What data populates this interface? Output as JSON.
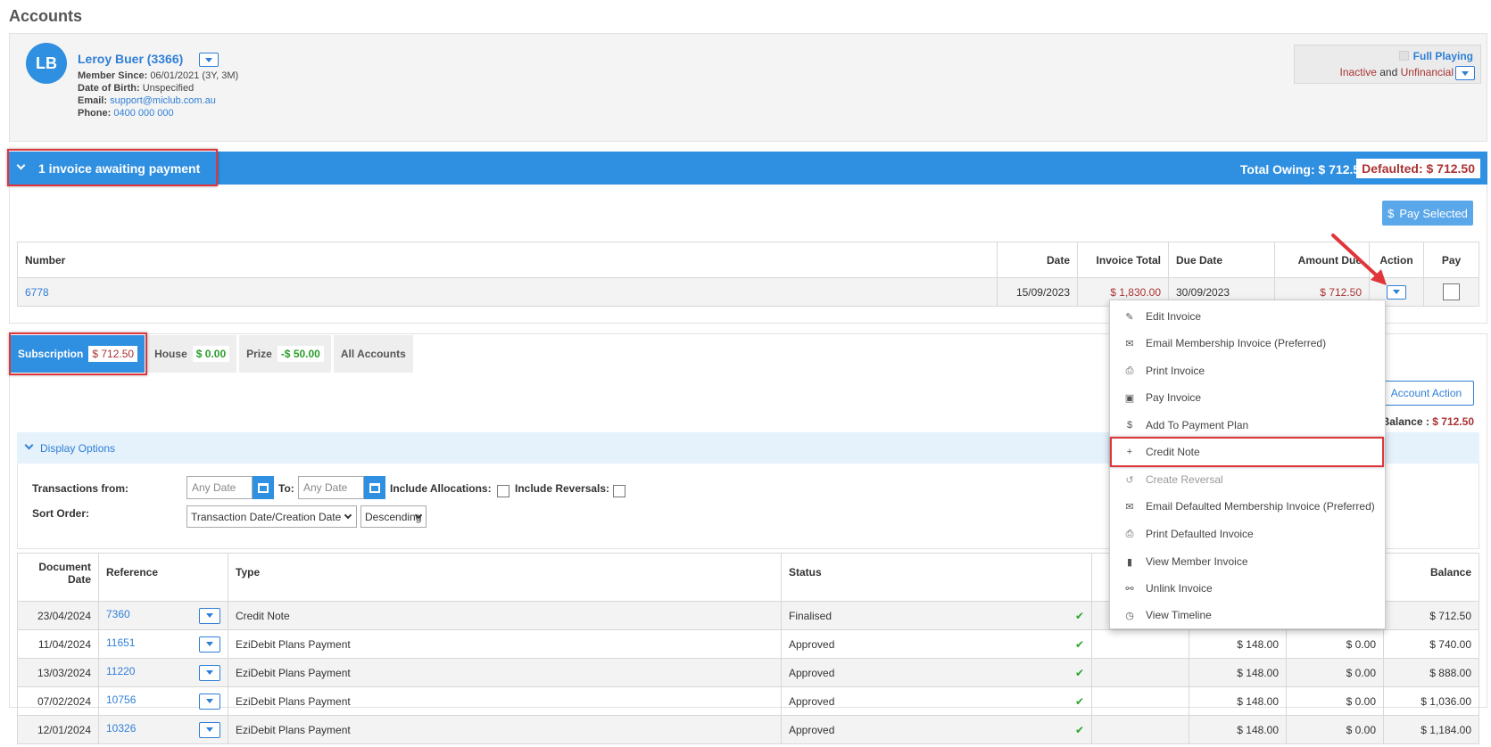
{
  "page": {
    "title": "Accounts"
  },
  "member": {
    "initials": "LB",
    "name": "Leroy Buer (3366)",
    "since_label": "Member Since:",
    "since_value": "06/01/2021 (3Y, 3M)",
    "dob_label": "Date of Birth:",
    "dob_value": "Unspecified",
    "email_label": "Email:",
    "email_value": "support@miclub.com.au",
    "phone_label": "Phone:",
    "phone_value": "0400 000 000",
    "status_title": "Full Playing",
    "status_inactive": "Inactive",
    "status_and": "and",
    "status_unfinancial": "Unfinancial"
  },
  "invoice_banner": {
    "title": "1 invoice awaiting payment",
    "total_owing": "Total Owing: $ 712.50",
    "defaulted": "Defaulted: $ 712.50"
  },
  "pay_selected_label": "Pay Selected",
  "invoice_table": {
    "headers": {
      "number": "Number",
      "date": "Date",
      "total": "Invoice Total",
      "due": "Due Date",
      "amount_due": "Amount Due",
      "action": "Action",
      "pay": "Pay"
    },
    "rows": [
      {
        "number": "6778",
        "date": "15/09/2023",
        "total": "$ 1,830.00",
        "due": "30/09/2023",
        "amount_due": "$ 712.50"
      }
    ]
  },
  "tabs": [
    {
      "label": "Subscription",
      "amount": "$ 712.50"
    },
    {
      "label": "House",
      "amount": "$ 0.00"
    },
    {
      "label": "Prize",
      "amount": "-$ 50.00"
    },
    {
      "label": "All Accounts",
      "amount": ""
    }
  ],
  "account_action_label": "Account Action",
  "balance": {
    "label": "Balance :",
    "value": "$ 712.50"
  },
  "display_options": {
    "label": "Display Options",
    "from_label": "Transactions from:",
    "from_placeholder": "Any Date",
    "to_label": "To:",
    "to_placeholder": "Any Date",
    "allocations_label": "Include Allocations:",
    "reversals_label": "Include Reversals:",
    "sort_label": "Sort Order:",
    "sort_value": "Transaction Date/Creation Date",
    "direction_value": "Descending"
  },
  "tx_table": {
    "headers": {
      "doc_date": "Document Date",
      "reference": "Reference",
      "type": "Type",
      "status": "Status",
      "balance": "Balance"
    },
    "rows": [
      {
        "date": "23/04/2024",
        "ref": "7360",
        "type": "Credit Note",
        "status": "Finalised",
        "debit": "",
        "credit": "",
        "balance": "$ 712.50"
      },
      {
        "date": "11/04/2024",
        "ref": "11651",
        "type": "EziDebit Plans Payment",
        "status": "Approved",
        "debit": "$ 148.00",
        "credit": "$ 0.00",
        "balance": "$ 740.00"
      },
      {
        "date": "13/03/2024",
        "ref": "11220",
        "type": "EziDebit Plans Payment",
        "status": "Approved",
        "debit": "$ 148.00",
        "credit": "$ 0.00",
        "balance": "$ 888.00"
      },
      {
        "date": "07/02/2024",
        "ref": "10756",
        "type": "EziDebit Plans Payment",
        "status": "Approved",
        "debit": "$ 148.00",
        "credit": "$ 0.00",
        "balance": "$ 1,036.00"
      },
      {
        "date": "12/01/2024",
        "ref": "10326",
        "type": "EziDebit Plans Payment",
        "status": "Approved",
        "debit": "$ 148.00",
        "credit": "$ 0.00",
        "balance": "$ 1,184.00"
      }
    ]
  },
  "action_menu": {
    "items": [
      {
        "label": "Edit Invoice",
        "icon": "pencil-icon"
      },
      {
        "label": "Email Membership Invoice (Preferred)",
        "icon": "envelope-icon"
      },
      {
        "label": "Print Invoice",
        "icon": "printer-icon"
      },
      {
        "label": "Pay Invoice",
        "icon": "money-icon"
      },
      {
        "label": "Add To Payment Plan",
        "icon": "dollar-icon"
      },
      {
        "label": "Credit Note",
        "icon": "plus-icon"
      },
      {
        "label": "Create Reversal",
        "icon": "undo-icon"
      },
      {
        "label": "Email Defaulted Membership Invoice (Preferred)",
        "icon": "envelope-icon"
      },
      {
        "label": "Print Defaulted Invoice",
        "icon": "printer-icon"
      },
      {
        "label": "View Member Invoice",
        "icon": "file-icon"
      },
      {
        "label": "Unlink Invoice",
        "icon": "unlink-icon"
      },
      {
        "label": "View Timeline",
        "icon": "clock-icon"
      }
    ]
  },
  "colors": {
    "primary": "#2f8fe0",
    "link": "#2f7fd6",
    "negative": "#a33333",
    "positive": "#2a9d2a",
    "highlight": "#e0353a"
  }
}
